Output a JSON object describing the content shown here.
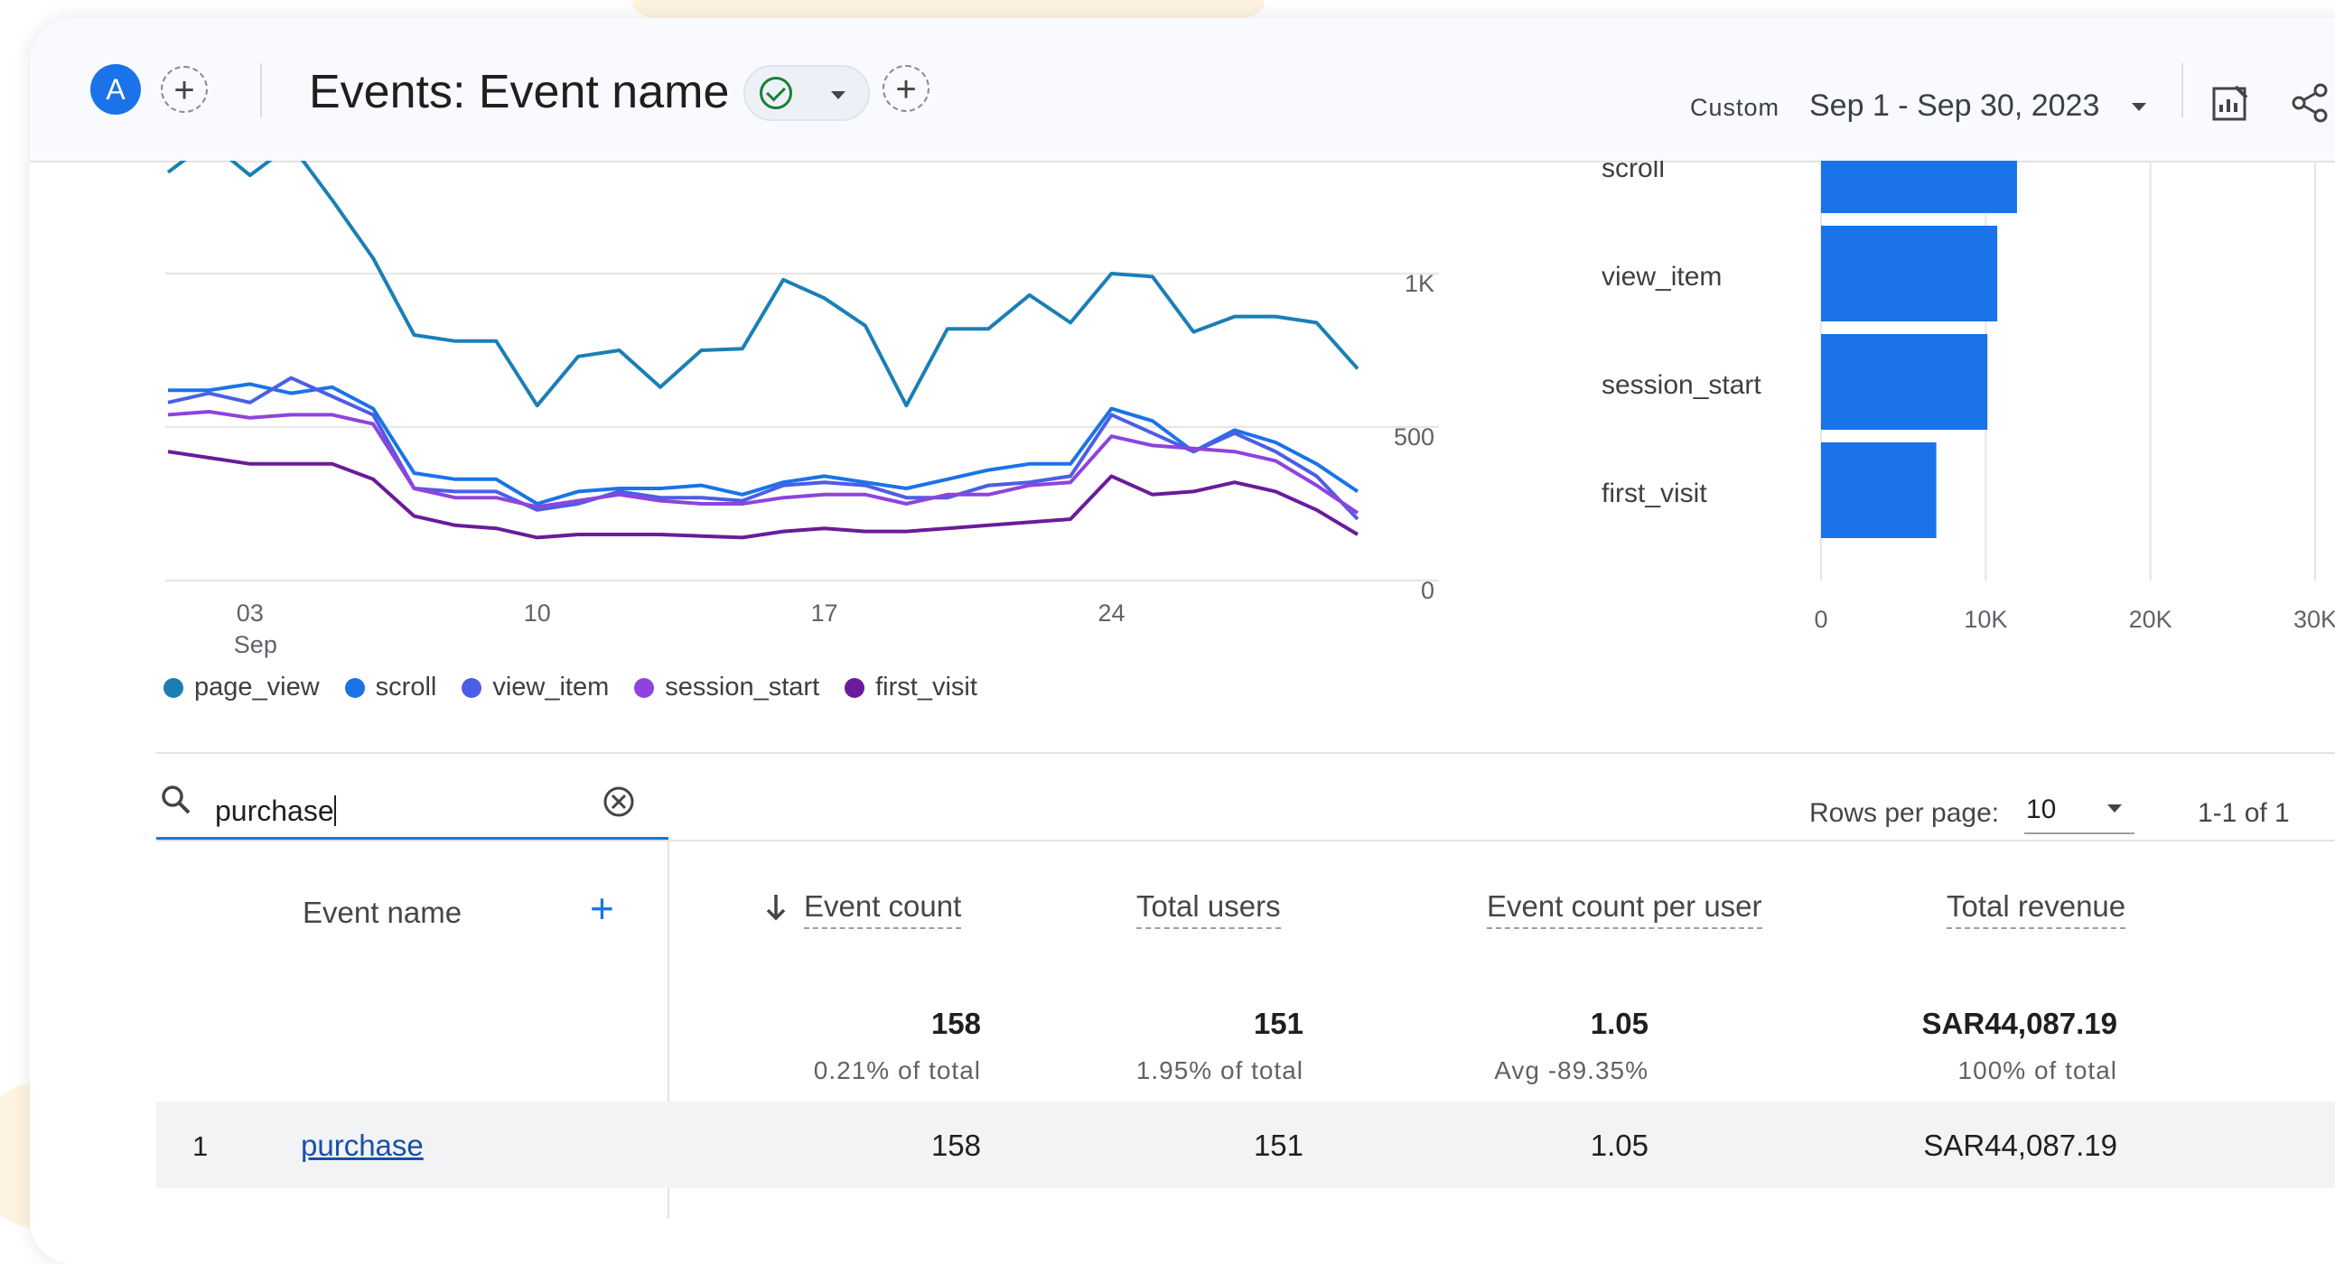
{
  "header": {
    "avatar_letter": "A",
    "title": "Events: Event name",
    "date_preset": "Custom",
    "date_range": "Sep 1 - Sep 30, 2023",
    "icons": [
      "plus-icon",
      "check-circle-icon",
      "chevron-down-icon",
      "plus-icon",
      "chevron-down-icon",
      "customize-report-icon",
      "share-icon"
    ]
  },
  "chart_data": [
    {
      "type": "line",
      "x_ticks": [
        "03",
        "10",
        "17",
        "24"
      ],
      "x_sublabel": "Sep",
      "y_ticks": [
        "0",
        "500",
        "1K"
      ],
      "ylim": [
        0,
        1300
      ],
      "legend_position": "bottom",
      "series": [
        {
          "name": "page_view",
          "color": "#1a7fb5",
          "values": [
            1330,
            1430,
            1320,
            1420,
            1240,
            1050,
            800,
            780,
            780,
            570,
            730,
            750,
            630,
            750,
            755,
            980,
            920,
            830,
            570,
            820,
            820,
            930,
            840,
            1000,
            990,
            810,
            860,
            860,
            840,
            690
          ]
        },
        {
          "name": "scroll",
          "color": "#1a73e8",
          "values": [
            620,
            620,
            640,
            610,
            630,
            560,
            350,
            330,
            330,
            250,
            290,
            300,
            300,
            310,
            280,
            320,
            340,
            320,
            300,
            330,
            360,
            380,
            380,
            560,
            520,
            420,
            490,
            450,
            380,
            290
          ]
        },
        {
          "name": "view_item",
          "color": "#4c5ee6",
          "values": [
            580,
            610,
            580,
            660,
            600,
            540,
            300,
            290,
            290,
            230,
            250,
            290,
            270,
            270,
            260,
            310,
            320,
            310,
            270,
            270,
            310,
            320,
            340,
            540,
            480,
            420,
            480,
            420,
            340,
            200
          ]
        },
        {
          "name": "session_start",
          "color": "#8e44dc",
          "values": [
            540,
            550,
            530,
            540,
            540,
            510,
            300,
            270,
            270,
            240,
            260,
            280,
            260,
            250,
            250,
            270,
            280,
            280,
            250,
            280,
            280,
            310,
            320,
            470,
            440,
            430,
            420,
            390,
            310,
            220
          ]
        },
        {
          "name": "first_visit",
          "color": "#6a1b9a",
          "values": [
            420,
            400,
            380,
            380,
            380,
            330,
            210,
            180,
            170,
            140,
            150,
            150,
            150,
            145,
            140,
            160,
            170,
            160,
            160,
            170,
            180,
            190,
            200,
            340,
            280,
            290,
            320,
            290,
            230,
            150
          ]
        }
      ]
    },
    {
      "type": "bar",
      "orientation": "horizontal",
      "categories": [
        "scroll",
        "view_item",
        "session_start",
        "first_visit"
      ],
      "values": [
        11900,
        10700,
        10100,
        7000
      ],
      "x_ticks": [
        "0",
        "10K",
        "20K",
        "30K"
      ],
      "xlim": [
        0,
        30000
      ],
      "color": "#1a73e8"
    }
  ],
  "legend": [
    {
      "label": "page_view",
      "color": "#1a7fb5"
    },
    {
      "label": "scroll",
      "color": "#1a73e8"
    },
    {
      "label": "view_item",
      "color": "#4c5ee6"
    },
    {
      "label": "session_start",
      "color": "#8e44dc"
    },
    {
      "label": "first_visit",
      "color": "#6a1b9a"
    }
  ],
  "search": {
    "value": "purchase"
  },
  "pagination": {
    "rows_label": "Rows per page:",
    "rows_value": "10",
    "range": "1-1 of 1"
  },
  "table": {
    "col_event": "Event name",
    "col_count": "Event count",
    "col_users": "Total users",
    "col_per_user": "Event count per user",
    "col_revenue": "Total revenue",
    "totals": {
      "count": "158",
      "count_sub": "0.21% of total",
      "users": "151",
      "users_sub": "1.95% of total",
      "per_user": "1.05",
      "per_user_sub": "Avg -89.35%",
      "revenue": "SAR44,087.19",
      "revenue_sub": "100% of total"
    },
    "rows": [
      {
        "index": "1",
        "event": "purchase",
        "count": "158",
        "users": "151",
        "per_user": "1.05",
        "revenue": "SAR44,087.19"
      }
    ]
  }
}
